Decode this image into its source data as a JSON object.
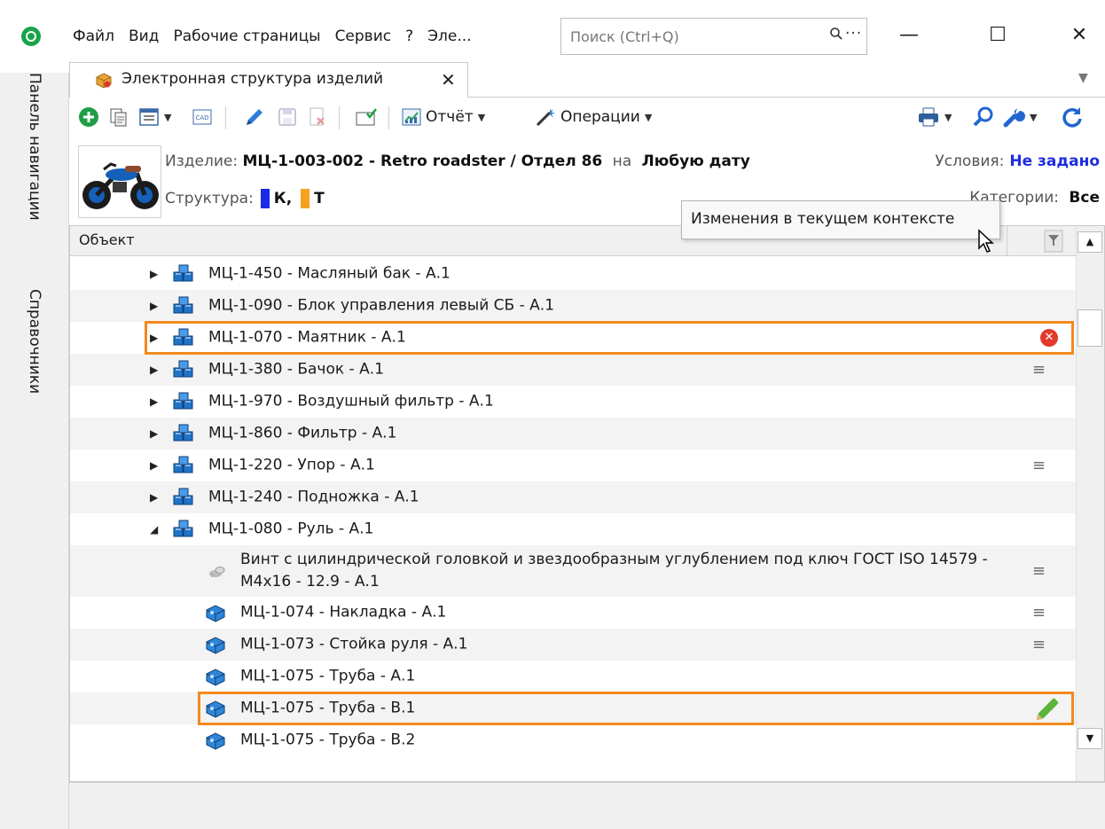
{
  "menu": [
    "Файл",
    "Вид",
    "Рабочие страницы",
    "Сервис",
    "?",
    "Эле..."
  ],
  "search": {
    "placeholder": "Поиск (Ctrl+Q)",
    "more": "···"
  },
  "window": {
    "minimize": "—",
    "maximize": "☐",
    "close": "✕"
  },
  "leftbar": {
    "navigation": "Панель навигации",
    "references": "Справочники"
  },
  "tab": {
    "label": "Электронная структура изделий",
    "close": "✕",
    "dropdown": "▼"
  },
  "toolbar": {
    "report": "Отчёт",
    "operations": "Операции"
  },
  "info": {
    "product_label": "Изделие:",
    "product_value": "МЦ-1-003-002 - Retro roadster / Отдел 86",
    "on_label": "на",
    "date_value": "Любую дату",
    "structure_label": "Структура:",
    "structure_k": "К,",
    "structure_t": "Т",
    "conditions_label": "Условия:",
    "conditions_value": "Не задано",
    "categories_label": "Категории:",
    "categories_value": "Все"
  },
  "grid": {
    "header": "Объект",
    "rows": [
      {
        "text": "МЦ-1-450 - Масляный бак - А.1"
      },
      {
        "text": "МЦ-1-090 - Блок управления левый СБ - А.1"
      },
      {
        "text": "МЦ-1-070 - Маятник - А.1",
        "status_icon": "error-icon"
      },
      {
        "text": "МЦ-1-380 - Бачок - А.1",
        "status": "≡"
      },
      {
        "text": "МЦ-1-970  - Воздушный фильтр - А.1"
      },
      {
        "text": "МЦ-1-860 - Фильтр - А.1"
      },
      {
        "text": "МЦ-1-220 - Упор - А.1",
        "status": "≡"
      },
      {
        "text": "МЦ-1-240  - Подножка - А.1"
      },
      {
        "text": "МЦ-1-080 - Руль - А.1"
      },
      {
        "text": "Винт с цилиндрической головкой и звездообразным углублением под ключ ГОСТ ISO 14579 - M4x16 - 12.9 - А.1",
        "status": "≡"
      },
      {
        "text": "МЦ-1-074 - Накладка - А.1",
        "status": "≡"
      },
      {
        "text": "МЦ-1-073 - Стойка руля - А.1",
        "status": "≡"
      },
      {
        "text": "МЦ-1-075 - Труба - А.1"
      },
      {
        "text": "МЦ-1-075 - Труба - B.1",
        "status_icon": "pencil-icon"
      },
      {
        "text": "МЦ-1-075 - Труба - B.2"
      }
    ]
  },
  "tooltip": "Изменения в текущем контексте",
  "colors": {
    "highlight": "#f28a1c",
    "conditions": "#1d2de0",
    "swatch_k": "#1a2be8",
    "swatch_t": "#f7a21b",
    "assembly_icon": "#1f73c9",
    "part_icon": "#2f86d6"
  }
}
